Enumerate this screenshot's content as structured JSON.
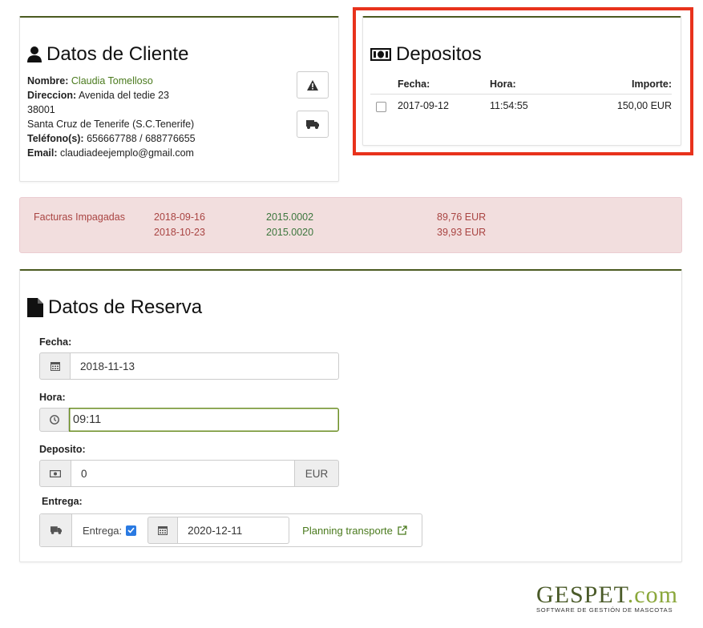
{
  "client": {
    "title": "Datos de Cliente",
    "nombre_label": "Nombre:",
    "nombre": "Claudia Tomelloso",
    "direccion_label": "Direccion:",
    "direccion": "Avenida del tedie 23",
    "cp": "38001",
    "ciudad": "Santa Cruz de Tenerife (S.C.Tenerife)",
    "telefono_label": "Teléfono(s):",
    "telefono": "656667788 / 688776655",
    "email_label": "Email:",
    "email": "claudiadeejemplo@gmail.com"
  },
  "depositos": {
    "title": "Depositos",
    "headers": {
      "fecha": "Fecha:",
      "hora": "Hora:",
      "importe": "Importe:"
    },
    "rows": [
      {
        "fecha": "2017-09-12",
        "hora": "11:54:55",
        "importe": "150,00 EUR"
      }
    ]
  },
  "facturas": {
    "label": "Facturas Impagadas",
    "rows": [
      {
        "fecha": "2018-09-16",
        "numero": "2015.0002",
        "importe": "89,76 EUR"
      },
      {
        "fecha": "2018-10-23",
        "numero": "2015.0020",
        "importe": "39,93 EUR"
      }
    ]
  },
  "reserva": {
    "title": "Datos de Reserva",
    "fecha_label": "Fecha:",
    "fecha": "2018-11-13",
    "hora_label": "Hora:",
    "hora": "09:11",
    "deposito_label": "Deposito:",
    "deposito": "0",
    "deposito_unit": "EUR",
    "entrega_label": "Entrega:",
    "entrega_check_label": "Entrega:",
    "entrega_fecha": "2020-12-11",
    "planning_link": "Planning transporte"
  },
  "logo": {
    "name": "GESPET",
    "suffix": ".com",
    "tagline": "SOFTWARE DE GESTIÓN DE MASCOTAS"
  },
  "colors": {
    "accent": "#4a7a1d",
    "highlight_frame": "#e8321c",
    "alert_bg": "#f2dede",
    "alert_text": "#a94442"
  }
}
